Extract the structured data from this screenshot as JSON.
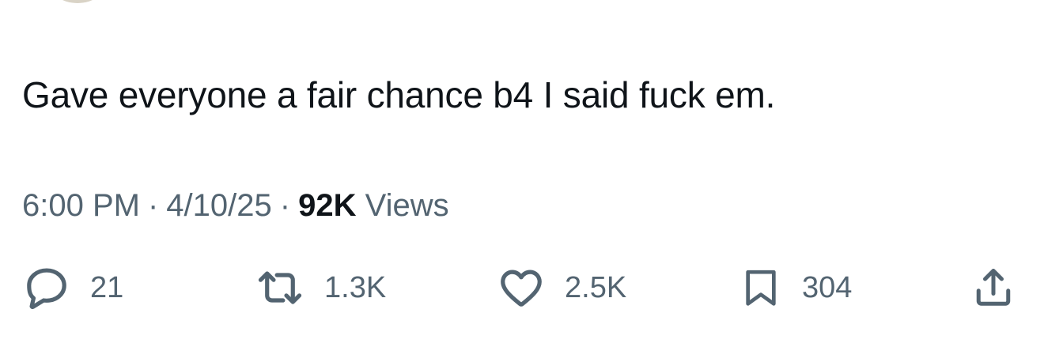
{
  "tweet": {
    "text": "Gave everyone a fair chance b4 I said fuck em."
  },
  "meta": {
    "time": "6:00 PM",
    "separator": "·",
    "date": "4/10/25",
    "views_count": "92K",
    "views_label": "Views"
  },
  "actions": {
    "reply_count": "21",
    "repost_count": "1.3K",
    "like_count": "2.5K",
    "bookmark_count": "304"
  },
  "icons": {
    "reply": "reply-icon",
    "repost": "repost-icon",
    "like": "heart-icon",
    "bookmark": "bookmark-icon",
    "share": "share-icon"
  },
  "colors": {
    "text": "#0f1419",
    "secondary": "#536471",
    "background": "#ffffff"
  }
}
